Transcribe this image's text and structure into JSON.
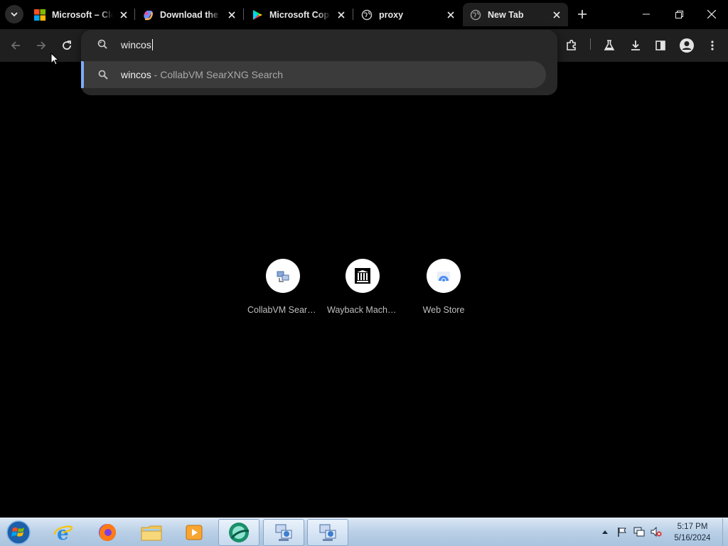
{
  "tabs": [
    {
      "title": "Microsoft – Cloud, Computers, Apps & Gaming",
      "favicon": "microsoft-logo-icon",
      "active": false
    },
    {
      "title": "Download the Copilot app",
      "favicon": "copilot-icon",
      "active": false
    },
    {
      "title": "Microsoft Copilot - Google Play",
      "favicon": "play-store-icon",
      "active": false
    },
    {
      "title": "proxy",
      "favicon": "globe-icon",
      "active": false
    },
    {
      "title": "New Tab",
      "favicon": "globe-icon",
      "active": true
    }
  ],
  "omnibox": {
    "input_value": "wincos",
    "suggestion": {
      "query": "wincos",
      "separator": " - ",
      "description": "CollabVM SearXNG Search",
      "icon": "search-icon"
    }
  },
  "shortcuts": [
    {
      "label": "CollabVM SearXNG",
      "icon": "collabvm-icon"
    },
    {
      "label": "Wayback Machine",
      "icon": "wayback-icon"
    },
    {
      "label": "Web Store",
      "icon": "web-store-icon"
    }
  ],
  "taskbar": {
    "apps": [
      {
        "name": "Internet Explorer",
        "icon": "ie-icon",
        "open": false
      },
      {
        "name": "Firefox",
        "icon": "firefox-icon",
        "open": false
      },
      {
        "name": "Windows Explorer",
        "icon": "folder-icon",
        "open": false
      },
      {
        "name": "Windows Media Player",
        "icon": "media-player-icon",
        "open": false
      },
      {
        "name": "Browser",
        "icon": "browser-icon",
        "open": true
      },
      {
        "name": "Network",
        "icon": "network-icon",
        "open": true
      },
      {
        "name": "Network 2",
        "icon": "network-icon",
        "open": true
      }
    ],
    "time": "5:17 PM",
    "date": "5/16/2024"
  },
  "colors": {
    "accent": "#7cacf8",
    "toolbar_bg": "#1f1f1f",
    "omnibox_bg": "#282828",
    "page_bg": "#000000"
  }
}
